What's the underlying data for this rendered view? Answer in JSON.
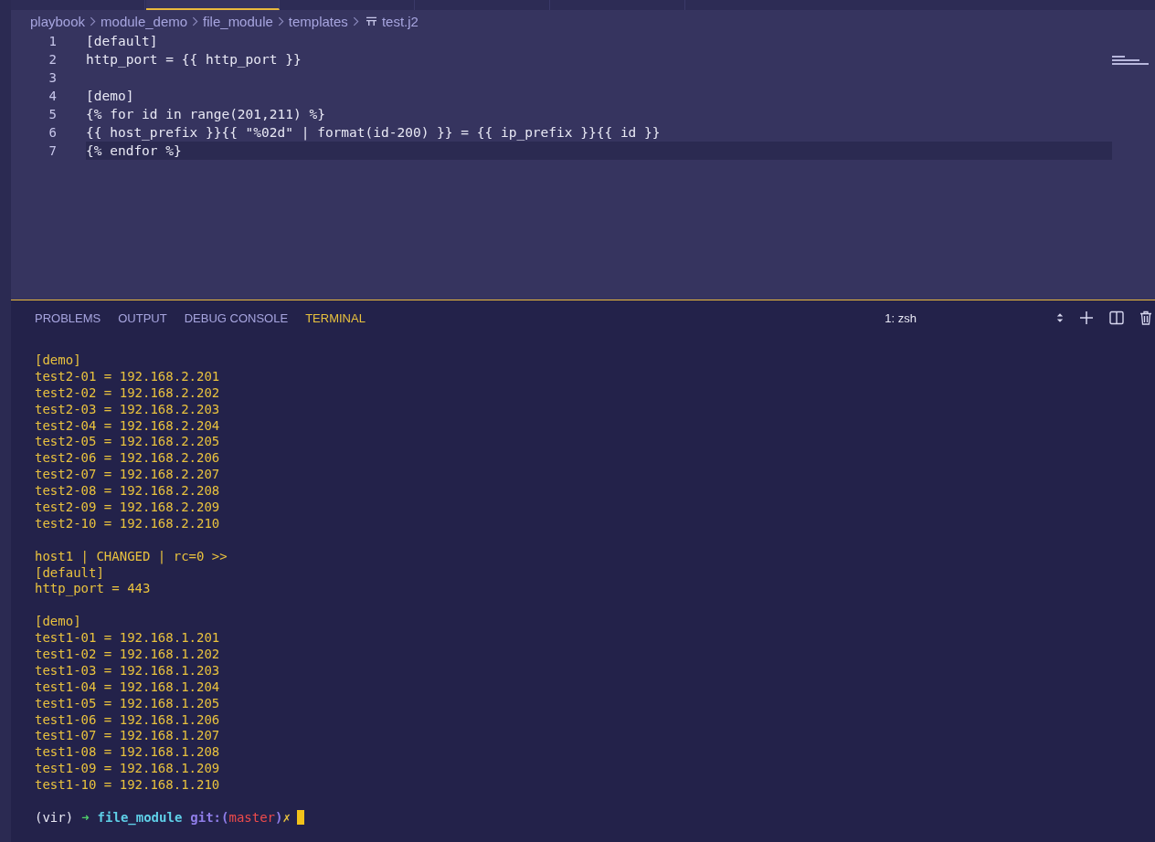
{
  "breadcrumb": [
    {
      "text": "playbook"
    },
    {
      "text": "module_demo"
    },
    {
      "text": "file_module"
    },
    {
      "text": "templates"
    },
    {
      "text": "test.j2",
      "kind": "file"
    }
  ],
  "editor": {
    "lines": [
      {
        "number": "1",
        "text": "[default]",
        "current": false
      },
      {
        "number": "2",
        "text": "http_port = {{ http_port }}",
        "current": false
      },
      {
        "number": "3",
        "current": false
      },
      {
        "number": "4",
        "text": "[demo]",
        "current": false
      },
      {
        "number": "5",
        "text": "{% for id in range(201,211) %}",
        "current": false
      },
      {
        "number": "6",
        "text": "{{ host_prefix }}{{ \"%02d\" | format(id-200) }} = {{ ip_prefix }}{{ id }}",
        "current": false
      },
      {
        "number": "7",
        "text": "{% endfor %}",
        "current": true
      }
    ]
  },
  "panel": {
    "tabs": [
      {
        "label": "PROBLEMS",
        "selected": false
      },
      {
        "label": "OUTPUT",
        "selected": false
      },
      {
        "label": "DEBUG CONSOLE",
        "selected": false
      },
      {
        "label": "TERMINAL",
        "selected": true
      }
    ],
    "terminal_select": "1: zsh",
    "terminal": {
      "lines": [
        {
          "text": "[demo]"
        },
        {
          "text": "test2-01 = 192.168.2.201"
        },
        {
          "text": "test2-02 = 192.168.2.202"
        },
        {
          "text": "test2-03 = 192.168.2.203"
        },
        {
          "text": "test2-04 = 192.168.2.204"
        },
        {
          "text": "test2-05 = 192.168.2.205"
        },
        {
          "text": "test2-06 = 192.168.2.206"
        },
        {
          "text": "test2-07 = 192.168.2.207"
        },
        {
          "text": "test2-08 = 192.168.2.208"
        },
        {
          "text": "test2-09 = 192.168.2.209"
        },
        {
          "text": "test2-10 = 192.168.2.210"
        },
        {
          "kind": "blank"
        },
        {
          "text": "host1 | CHANGED | rc=0 >>"
        },
        {
          "text": "[default]"
        },
        {
          "text": "http_port = 443"
        },
        {
          "kind": "blank"
        },
        {
          "text": "[demo]"
        },
        {
          "text": "test1-01 = 192.168.1.201"
        },
        {
          "text": "test1-02 = 192.168.1.202"
        },
        {
          "text": "test1-03 = 192.168.1.203"
        },
        {
          "text": "test1-04 = 192.168.1.204"
        },
        {
          "text": "test1-05 = 192.168.1.205"
        },
        {
          "text": "test1-06 = 192.168.1.206"
        },
        {
          "text": "test1-07 = 192.168.1.207"
        },
        {
          "text": "test1-08 = 192.168.1.208"
        },
        {
          "text": "test1-09 = 192.168.1.209"
        },
        {
          "text": "test1-10 = 192.168.1.210"
        },
        {
          "kind": "blank"
        }
      ],
      "prompt": [
        {
          "text": "(vir)",
          "kind": "env"
        },
        {
          "text": "➜",
          "kind": "arrow"
        },
        {
          "text": "file_module",
          "kind": "dir"
        },
        {
          "text": "git:(",
          "kind": "git"
        },
        {
          "text": "master",
          "kind": "branch"
        },
        {
          "text": ")",
          "kind": "git"
        },
        {
          "text": "✗",
          "kind": "dirty"
        }
      ]
    }
  }
}
